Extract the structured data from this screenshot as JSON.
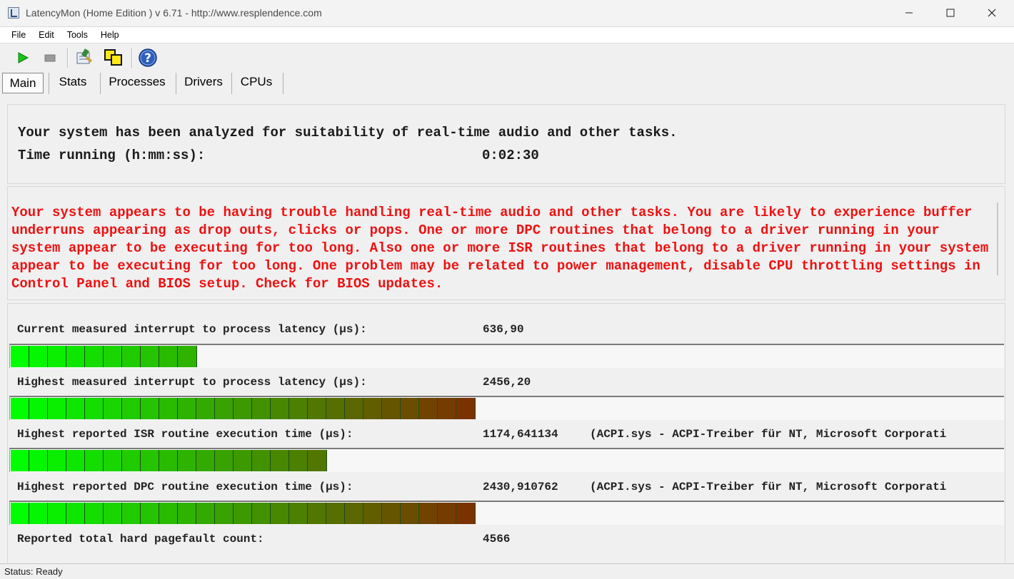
{
  "window": {
    "title": "LatencyMon  (Home Edition )  v 6.71 - http://www.resplendence.com"
  },
  "menu": {
    "items": [
      "File",
      "Edit",
      "Tools",
      "Help"
    ]
  },
  "toolbar": {
    "icons": [
      "start-icon",
      "stop-icon",
      "report-icon",
      "copy-icon",
      "help-icon"
    ]
  },
  "tabs": {
    "items": [
      "Main",
      "Stats",
      "Processes",
      "Drivers",
      "CPUs"
    ],
    "active": "Main"
  },
  "summary": {
    "headline": "Your system has been analyzed for suitability of real-time audio and other tasks.",
    "time_label": "Time running (h:mm:ss):",
    "time_value": "0:02:30"
  },
  "warning": {
    "text": "Your system appears to be having trouble handling real-time audio and other tasks. You are likely to experience buffer underruns appearing as drop outs, clicks or pops. One or more DPC routines that belong to a driver running in your system appear to be executing for too long. Also one or more ISR routines that belong to a driver running in your system appear to be executing for too long. One problem may be related to power management, disable CPU throttling settings in Control Panel and BIOS setup. Check for BIOS updates.",
    "color": "#ee1111"
  },
  "measurements": [
    {
      "label": "Current measured interrupt to process latency (µs):",
      "value": "636,90",
      "detail": "",
      "bar_segments": 10
    },
    {
      "label": "Highest measured interrupt to process latency (µs):",
      "value": "2456,20",
      "detail": "",
      "bar_segments": 25
    },
    {
      "label": "Highest reported ISR routine execution time (µs):",
      "value": "1174,641134",
      "detail": "(ACPI.sys - ACPI-Treiber für NT, Microsoft Corporati",
      "bar_segments": 17
    },
    {
      "label": "Highest reported DPC routine execution time (µs):",
      "value": "2430,910762",
      "detail": "(ACPI.sys - ACPI-Treiber für NT, Microsoft Corporati",
      "bar_segments": 25
    }
  ],
  "pagefault": {
    "label": "Reported total hard pagefault count:",
    "value": "4566"
  },
  "status": {
    "text": "Status: Ready"
  },
  "colors": {
    "bar_start": "#00ff00",
    "bar_end": "#7a3300",
    "warning_text": "#ee1111"
  }
}
